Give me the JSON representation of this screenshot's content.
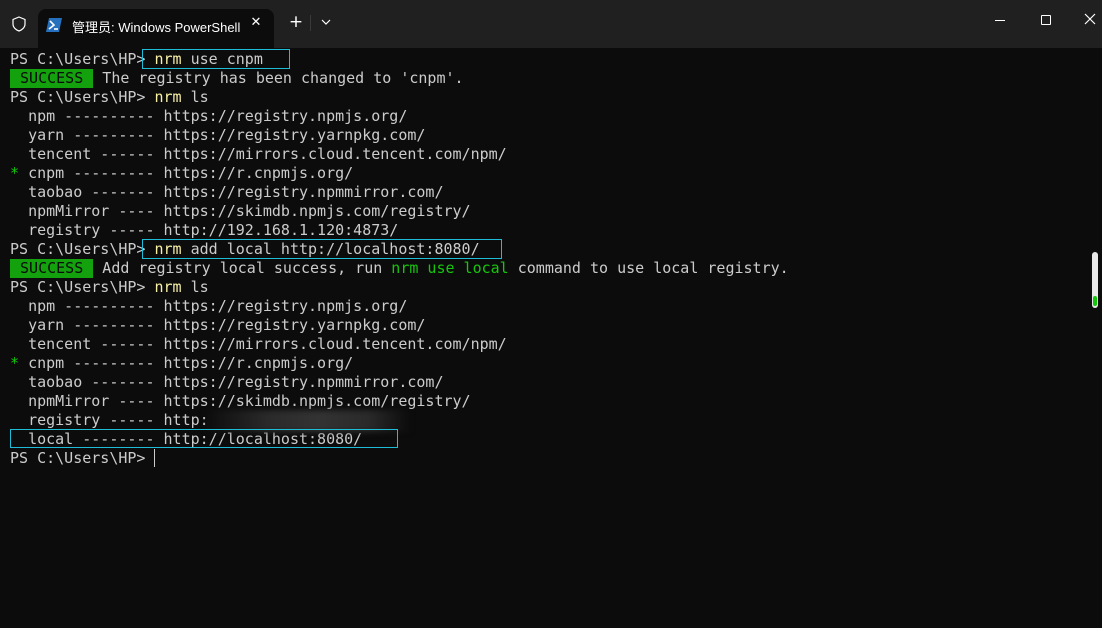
{
  "window": {
    "tab_title": "管理员: Windows PowerShell",
    "tab_close": "✕",
    "new_tab": "+",
    "dropdown": "⌄"
  },
  "terminal": {
    "prompt": "PS C:\\Users\\HP>",
    "lines": {
      "l1_cmd": "nrm",
      "l1_args": " use cnpm",
      "l2_badge": " SUCCESS ",
      "l2_text": " The registry has been changed to 'cnpm'.",
      "l3_cmd": "nrm",
      "l3_args": " ls",
      "l13_cmd": "nrm",
      "l13_args": " add local http://localhost:8080/",
      "l14_badge": " SUCCESS ",
      "l14_text_a": " Add registry local success, run ",
      "l14_cmd_green": "nrm use local",
      "l14_text_b": " command to use local registry.",
      "l15_cmd": "nrm",
      "l15_args": " ls"
    },
    "list1": [
      {
        "marker": " ",
        "name": "npm ---------- ",
        "url": "https://registry.npmjs.org/"
      },
      {
        "marker": " ",
        "name": "yarn --------- ",
        "url": "https://registry.yarnpkg.com/"
      },
      {
        "marker": " ",
        "name": "tencent ------ ",
        "url": "https://mirrors.cloud.tencent.com/npm/"
      },
      {
        "marker": "*",
        "name": "cnpm --------- ",
        "url": "https://r.cnpmjs.org/"
      },
      {
        "marker": " ",
        "name": "taobao ------- ",
        "url": "https://registry.npmmirror.com/"
      },
      {
        "marker": " ",
        "name": "npmMirror ---- ",
        "url": "https://skimdb.npmjs.com/registry/"
      },
      {
        "marker": " ",
        "name": "registry ----- ",
        "url": "http://192.168.1.120:4873/"
      }
    ],
    "list2": [
      {
        "marker": " ",
        "name": "npm ---------- ",
        "url": "https://registry.npmjs.org/"
      },
      {
        "marker": " ",
        "name": "yarn --------- ",
        "url": "https://registry.yarnpkg.com/"
      },
      {
        "marker": " ",
        "name": "tencent ------ ",
        "url": "https://mirrors.cloud.tencent.com/npm/"
      },
      {
        "marker": "*",
        "name": "cnpm --------- ",
        "url": "https://r.cnpmjs.org/"
      },
      {
        "marker": " ",
        "name": "taobao ------- ",
        "url": "https://registry.npmmirror.com/"
      },
      {
        "marker": " ",
        "name": "npmMirror ---- ",
        "url": "https://skimdb.npmjs.com/registry/"
      },
      {
        "marker": " ",
        "name": "registry ----- ",
        "url": "http:"
      },
      {
        "marker": " ",
        "name": "local -------- ",
        "url": "http://localhost:8080/"
      }
    ]
  },
  "colors": {
    "background": "#0c0c0c",
    "command": "#f9f1a5",
    "success_bg": "#13a10e",
    "green": "#16c60c",
    "highlight_box": "#1ebcd7"
  }
}
